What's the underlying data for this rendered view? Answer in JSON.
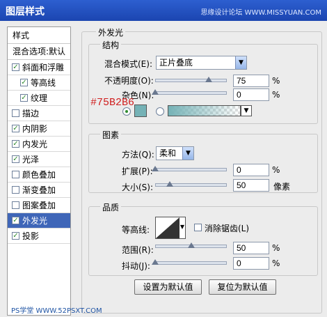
{
  "window": {
    "title": "图层样式",
    "watermark": "思缘设计论坛 WWW.MISSYUAN.COM"
  },
  "styles_panel": {
    "header": "样式",
    "blend_default": "混合选项:默认",
    "items": [
      {
        "label": "斜面和浮雕",
        "checked": true
      },
      {
        "label": "等高线",
        "checked": true,
        "indent": true
      },
      {
        "label": "纹理",
        "checked": true,
        "indent": true
      },
      {
        "label": "描边",
        "checked": false
      },
      {
        "label": "内阴影",
        "checked": true
      },
      {
        "label": "内发光",
        "checked": true
      },
      {
        "label": "光泽",
        "checked": true
      },
      {
        "label": "颜色叠加",
        "checked": false
      },
      {
        "label": "渐变叠加",
        "checked": false
      },
      {
        "label": "图案叠加",
        "checked": false
      },
      {
        "label": "外发光",
        "checked": true,
        "selected": true
      },
      {
        "label": "投影",
        "checked": true
      }
    ]
  },
  "outer_glow": {
    "title": "外发光",
    "structure": {
      "title": "结构",
      "blend_mode_label": "混合模式(E):",
      "blend_mode_value": "正片叠底",
      "opacity_label": "不透明度(O):",
      "opacity_value": "75",
      "opacity_level": 0.75,
      "noise_label": "杂色(N):",
      "noise_value": "0",
      "noise_level": 0,
      "color_annotation": "#75B2B6",
      "glow_color": "#75b2b6"
    },
    "elements": {
      "title": "图素",
      "technique_label": "方法(Q):",
      "technique_value": "柔和",
      "spread_label": "扩展(P):",
      "spread_value": "0",
      "spread_level": 0,
      "size_label": "大小(S):",
      "size_value": "50",
      "size_level": 0.2,
      "size_unit": "像素"
    },
    "quality": {
      "title": "品质",
      "contour_label": "等高线:",
      "antialias_label": "消除锯齿(L)",
      "range_label": "范围(R):",
      "range_value": "50",
      "range_level": 0.5,
      "jitter_label": "抖动(J):",
      "jitter_value": "0",
      "jitter_level": 0
    },
    "buttons": {
      "make_default": "设置为默认值",
      "reset_default": "复位为默认值"
    },
    "percent": "%"
  },
  "footer_watermark": "PS学堂 WWW.52PSXT.COM"
}
